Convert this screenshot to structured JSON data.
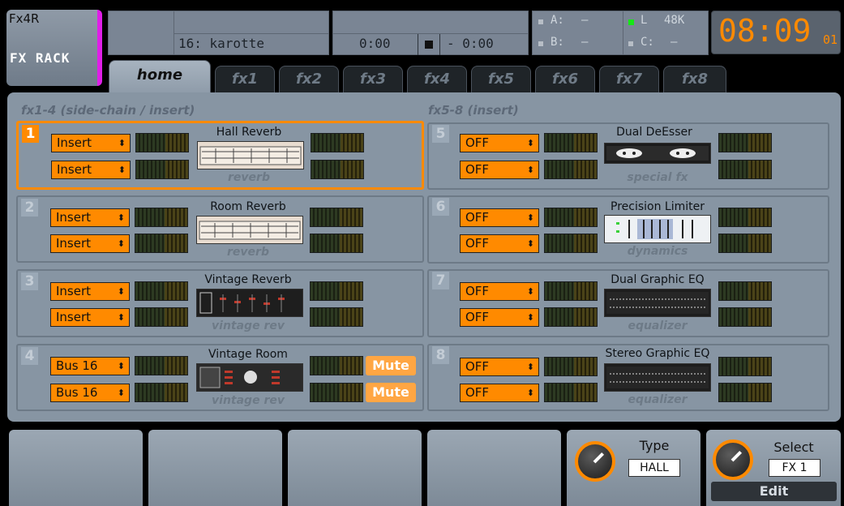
{
  "app": {
    "name": "Fx4R",
    "brand": "FX RACK"
  },
  "header": {
    "show_name": "16: karotte",
    "time_elapsed": "0:00",
    "time_remaining": "- 0:00",
    "stop_icon": "stop-icon"
  },
  "status": {
    "a_label": "A:",
    "a_value": "–",
    "b_label": "B:",
    "b_value": "–",
    "l_label": "L",
    "l_value": "48K",
    "c_label": "C:",
    "c_value": "–"
  },
  "clock": {
    "hhmm": "08:09",
    "frames": "01"
  },
  "tabs": [
    {
      "label": "home",
      "active": true
    },
    {
      "label": "fx1"
    },
    {
      "label": "fx2"
    },
    {
      "label": "fx3"
    },
    {
      "label": "fx4"
    },
    {
      "label": "fx5"
    },
    {
      "label": "fx6"
    },
    {
      "label": "fx7"
    },
    {
      "label": "fx8"
    }
  ],
  "sections": {
    "left": "fx1-4 (side-chain / insert)",
    "right": "fx5-8 (insert)"
  },
  "slots": [
    {
      "num": "1",
      "name": "Hall Reverb",
      "category": "reverb",
      "in1": "Insert",
      "in2": "Insert"
    },
    {
      "num": "2",
      "name": "Room Reverb",
      "category": "reverb",
      "in1": "Insert",
      "in2": "Insert"
    },
    {
      "num": "3",
      "name": "Vintage Reverb",
      "category": "vintage rev",
      "in1": "Insert",
      "in2": "Insert"
    },
    {
      "num": "4",
      "name": "Vintage Room",
      "category": "vintage rev",
      "in1": "Bus 16",
      "in2": "Bus 16",
      "mute1": "Mute",
      "mute2": "Mute"
    },
    {
      "num": "5",
      "name": "Dual DeEsser",
      "category": "special fx",
      "in1": "OFF",
      "in2": "OFF"
    },
    {
      "num": "6",
      "name": "Precision Limiter",
      "category": "dynamics",
      "in1": "OFF",
      "in2": "OFF"
    },
    {
      "num": "7",
      "name": "Dual Graphic EQ",
      "category": "equalizer",
      "in1": "OFF",
      "in2": "OFF"
    },
    {
      "num": "8",
      "name": "Stereo Graphic EQ",
      "category": "equalizer",
      "in1": "OFF",
      "in2": "OFF"
    }
  ],
  "controls": {
    "type": {
      "label": "Type",
      "value": "HALL"
    },
    "select": {
      "label": "Select",
      "value": "FX 1",
      "edit": "Edit"
    }
  },
  "colors": {
    "accent": "#ff8a00",
    "panel": "#8795a3",
    "magenta": "#e01ee8"
  }
}
